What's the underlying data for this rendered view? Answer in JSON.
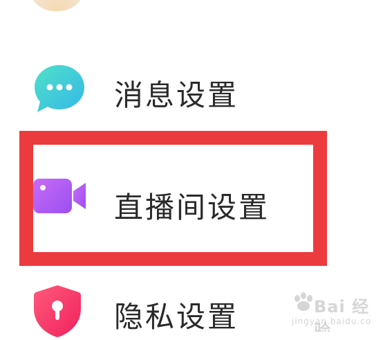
{
  "settings": {
    "items": [
      {
        "label": "消息设置",
        "icon": "chat-bubble-icon",
        "color": "#3ecfcf"
      },
      {
        "label": "直播间设置",
        "icon": "video-camera-icon",
        "color": "#b45cf5"
      },
      {
        "label": "隐私设置",
        "icon": "shield-keyhole-icon",
        "color": "#f23d6d"
      }
    ]
  },
  "highlight": {
    "color": "#ec3b3f"
  },
  "watermark": {
    "brand": "Bai 经验",
    "url": "jingyan.baidu.com"
  }
}
